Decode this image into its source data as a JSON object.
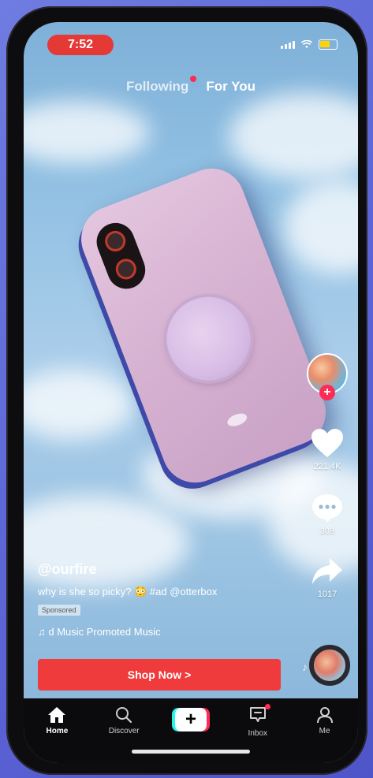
{
  "status": {
    "time": "7:52"
  },
  "top_tabs": [
    {
      "label": "Following"
    },
    {
      "label": "For You"
    }
  ],
  "post": {
    "username": "@ourfire",
    "description": "why is she so picky? 😳 #ad @otterbox",
    "sponsored_label": "Sponsored",
    "music": "♫ d Music   Promoted Music",
    "cta_label": "Shop Now >"
  },
  "actions": {
    "likes": "221.4K",
    "comments": "309",
    "shares": "1017"
  },
  "bottom_nav": [
    {
      "label": "Home"
    },
    {
      "label": "Discover"
    },
    {
      "label": ""
    },
    {
      "label": "Inbox"
    },
    {
      "label": "Me"
    }
  ],
  "colors": {
    "accent": "#fe2c55",
    "cta": "#ef3b3b",
    "time_pill": "#e53935"
  }
}
